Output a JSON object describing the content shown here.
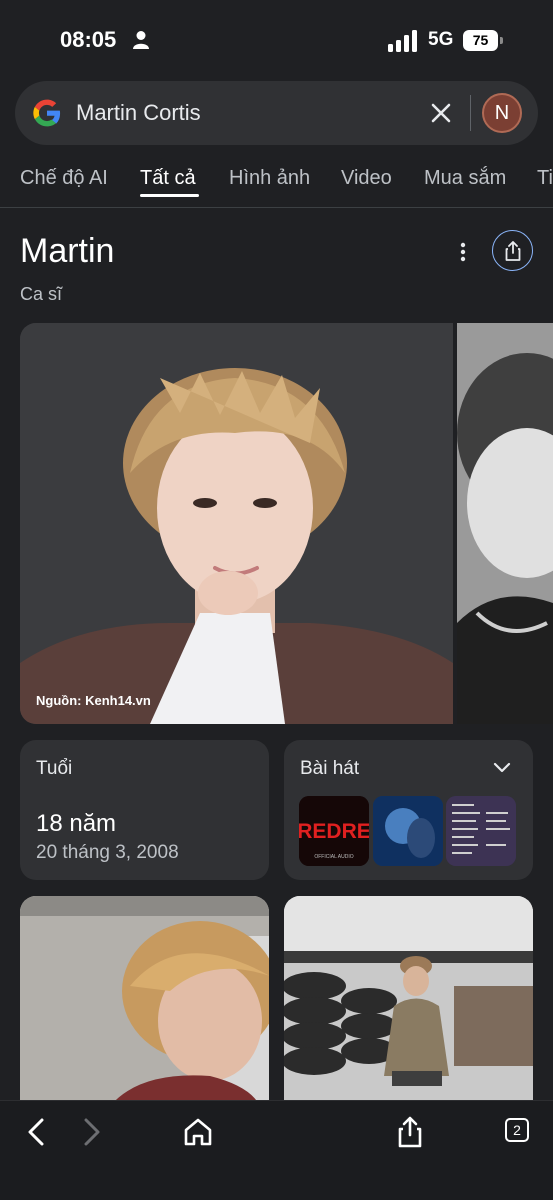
{
  "status_bar": {
    "time": "08:05",
    "network": "5G",
    "battery": "75"
  },
  "search": {
    "query": "Martin Cortis",
    "avatar_letter": "N"
  },
  "tabs": [
    {
      "label": "Chế độ AI",
      "active": false
    },
    {
      "label": "Tất cả",
      "active": true
    },
    {
      "label": "Hình ảnh",
      "active": false
    },
    {
      "label": "Video",
      "active": false
    },
    {
      "label": "Mua sắm",
      "active": false
    },
    {
      "label": "Ti",
      "active": false
    }
  ],
  "knowledge_panel": {
    "title": "Martin",
    "subtitle": "Ca sĩ",
    "image_source": "Nguồn: Kenh14.vn"
  },
  "age_card": {
    "label": "Tuổi",
    "value": "18 năm",
    "birth_date": "20 tháng 3, 2008"
  },
  "songs_card": {
    "label": "Bài hát",
    "thumbnail_1_text": "REDRE",
    "thumbnail_1_caption": "OFFICIAL AUDIO"
  },
  "bottom_bar": {
    "open_tabs": "2"
  },
  "colors": {
    "background": "#1f2023",
    "surface": "#303134",
    "accent_blue": "#8ab4f8"
  }
}
